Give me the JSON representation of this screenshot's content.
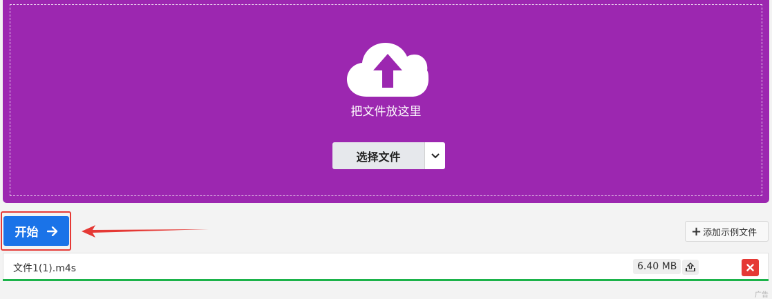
{
  "upload": {
    "drop_text": "把文件放这里",
    "choose_label": "选择文件",
    "icon": "cloud-upload-icon"
  },
  "actions": {
    "start_label": "开始",
    "add_sample_label": "添加示例文件"
  },
  "file": {
    "name": "文件1(1).m4s",
    "size": "6.40 MB",
    "progress": 1.0
  },
  "ad_label": "广告",
  "colors": {
    "dropzone": "#9c27b0",
    "start_button": "#1a73e8",
    "highlight": "#e53935",
    "progress": "#1bb34a",
    "remove_button": "#e53935"
  }
}
